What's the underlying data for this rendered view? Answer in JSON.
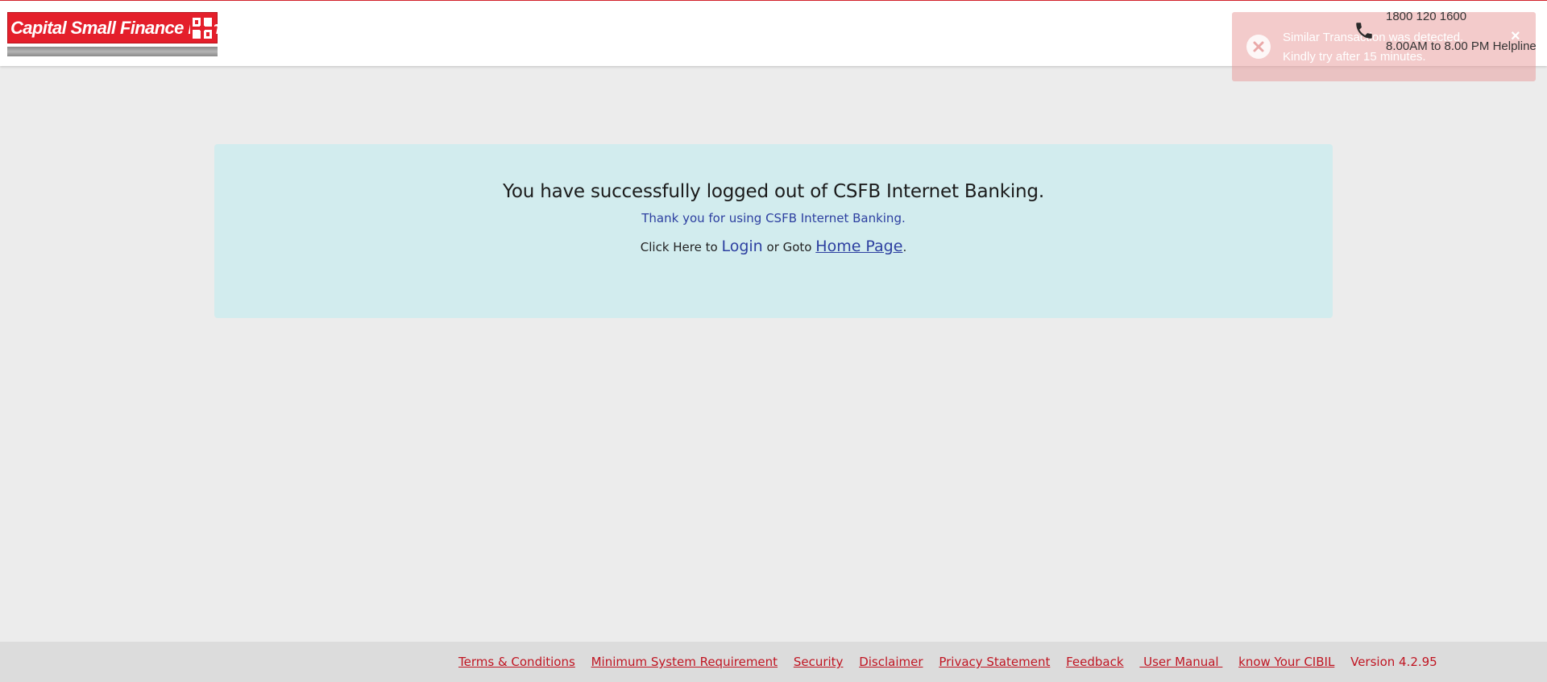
{
  "header": {
    "logo_text": "Capital Small Finance Bank",
    "helpline_number": "1800 120 1600",
    "helpline_hours": "8.00AM to 8.00 PM Helpline"
  },
  "toast": {
    "line1": "Similar Transaction was detected.",
    "line2": "Kindly try after 15 minutes.",
    "close_label": "×"
  },
  "main": {
    "title": "You have successfully logged out of CSFB Internet Banking.",
    "subtitle": "Thank you for using CSFB Internet Banking.",
    "click_prefix": "Click Here to",
    "login_label": "Login",
    "or_goto": "or Goto",
    "home_label": "Home Page",
    "period": "."
  },
  "footer": {
    "links": [
      "Terms & Conditions",
      "Minimum System Requirement",
      "Security",
      "Disclaimer",
      "Privacy Statement",
      "Feedback",
      " User Manual ",
      "know Your CIBIL"
    ],
    "version": "Version 4.2.95"
  },
  "colors": {
    "brand_red": "#e41f2b",
    "card_bg": "#d2ecee",
    "link_blue": "#2c3fa0",
    "footer_link": "#c01522"
  },
  "icons": [
    "phone-icon",
    "error-circle-icon",
    "close-icon",
    "bank-logo"
  ]
}
